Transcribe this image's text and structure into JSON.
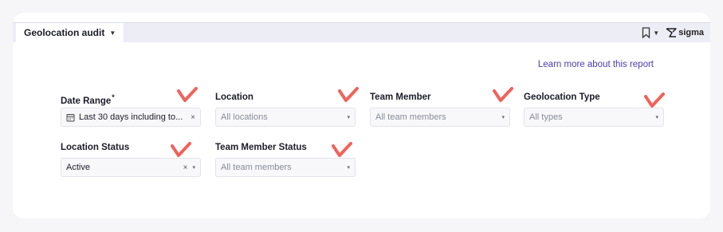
{
  "header": {
    "report_title": "Geolocation audit",
    "brand": "sigma"
  },
  "learn_more": "Learn more about this report",
  "filters": {
    "date_range": {
      "label": "Date Range",
      "required_mark": "*",
      "value": "Last 30 days including to..."
    },
    "location": {
      "label": "Location",
      "placeholder": "All locations"
    },
    "team_member": {
      "label": "Team Member",
      "placeholder": "All team members"
    },
    "geolocation_type": {
      "label": "Geolocation Type",
      "placeholder": "All types"
    },
    "location_status": {
      "label": "Location Status",
      "value": "Active"
    },
    "team_member_status": {
      "label": "Team Member Status",
      "placeholder": "All team members"
    }
  },
  "icons": {
    "calendar": "calendar-icon",
    "bookmark": "bookmark-icon",
    "clear": "×",
    "dropdown": "▾",
    "check": "check-mark-icon"
  },
  "colors": {
    "accent": "#4b3bb6",
    "check_mark": "#f1625a",
    "page_bg": "#f6f6f8",
    "topbar_bg": "#ededf6"
  }
}
